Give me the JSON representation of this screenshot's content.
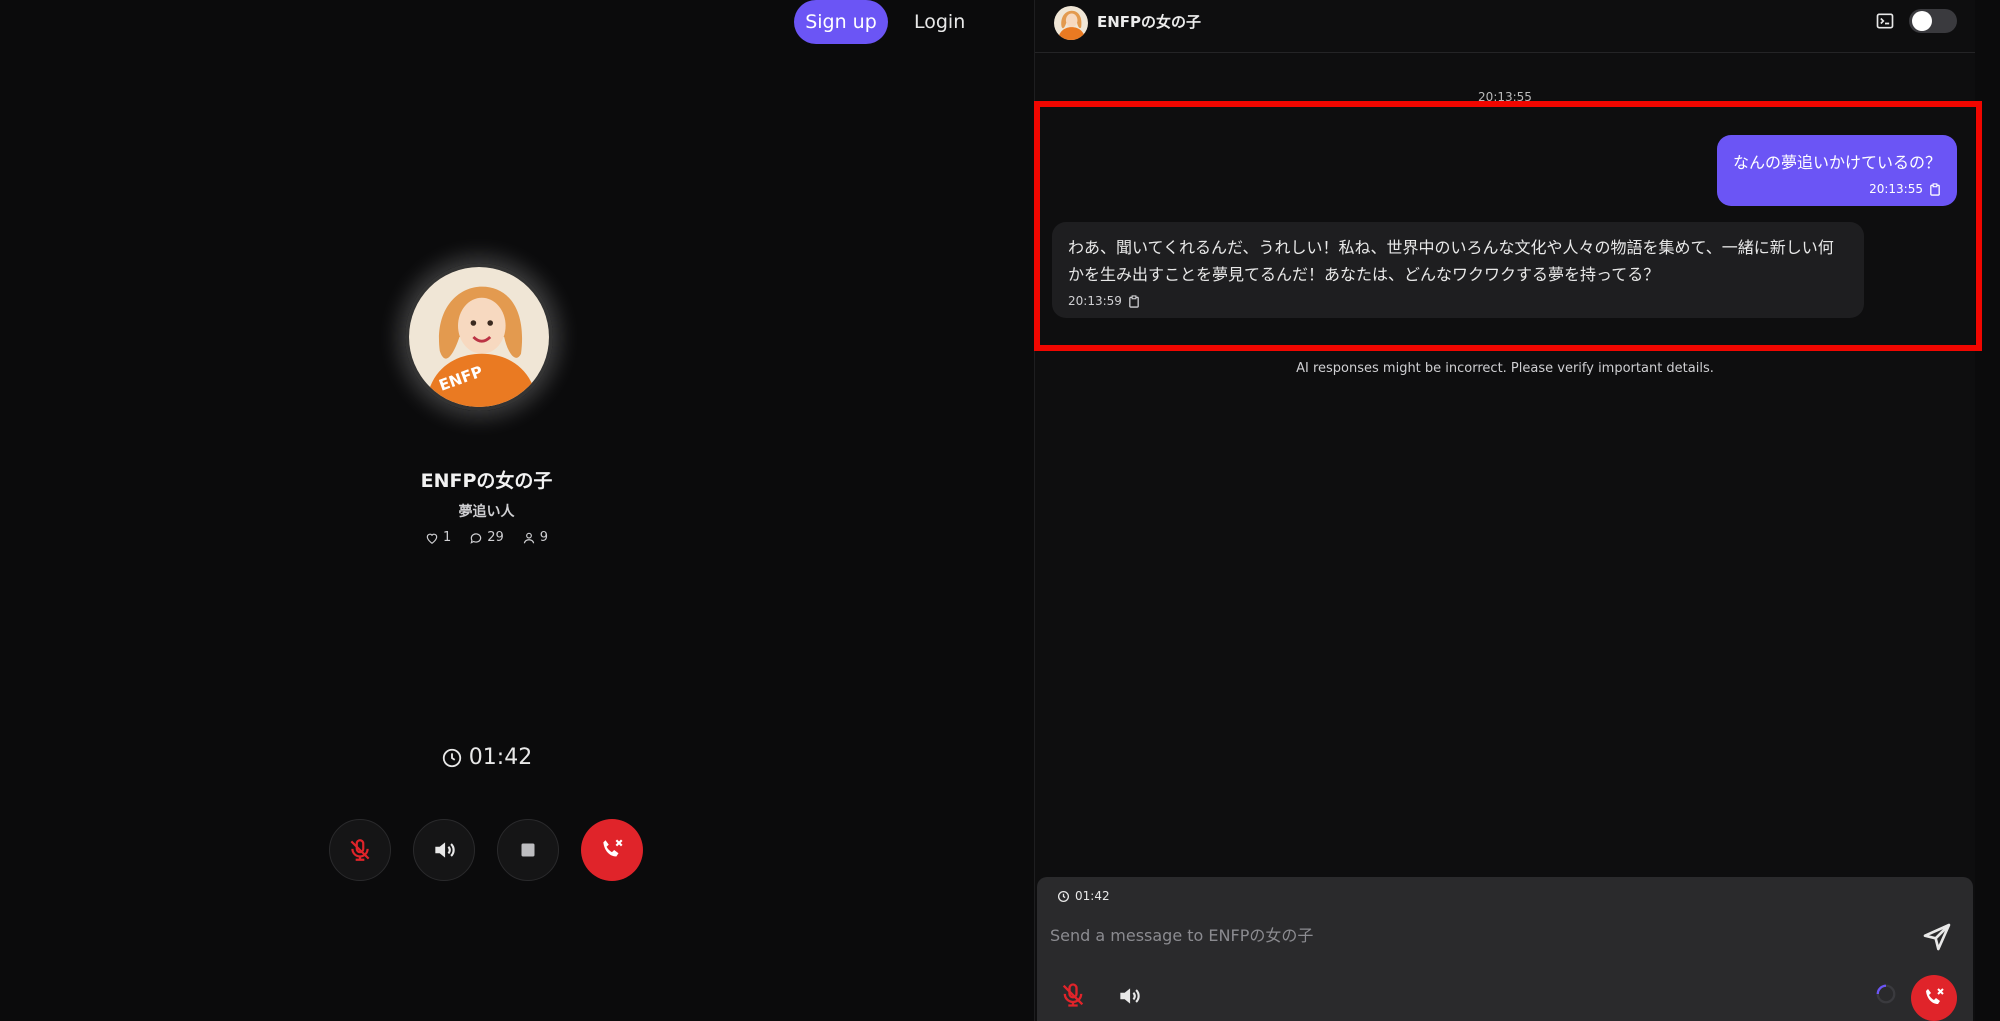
{
  "nav": {
    "signup_label": "Sign up",
    "login_label": "Login"
  },
  "profile": {
    "name": "ENFPの女の子",
    "tagline": "夢追い人",
    "avatar_text": "ENFP",
    "likes": "1",
    "comments": "29",
    "users": "9"
  },
  "call": {
    "timer": "01:42",
    "controls": [
      "mic-off-icon",
      "speaker-icon",
      "stop-icon",
      "end-call-icon"
    ]
  },
  "chat": {
    "title": "ENFPの女の子",
    "day_stamp": "20:13:55",
    "messages": [
      {
        "role": "user",
        "text": "なんの夢追いかけているの？",
        "time": "20:13:55"
      },
      {
        "role": "assistant",
        "text": "わあ、聞いてくれるんだ、うれしい！私ね、世界中のいろんな文化や人々の物語を集めて、一緒に新しい何かを生み出すことを夢見てるんだ！あなたは、どんなワクワクする夢を持ってる？",
        "time": "20:13:59"
      }
    ],
    "disclaimer": "AI responses might be incorrect. Please verify important details."
  },
  "composer": {
    "timer": "01:42",
    "placeholder": "Send a message to ENFPの女の子"
  },
  "colors": {
    "accent": "#6b55f5",
    "danger": "#e0242a",
    "highlight": "#f00600",
    "background": "#0b0b0c"
  }
}
